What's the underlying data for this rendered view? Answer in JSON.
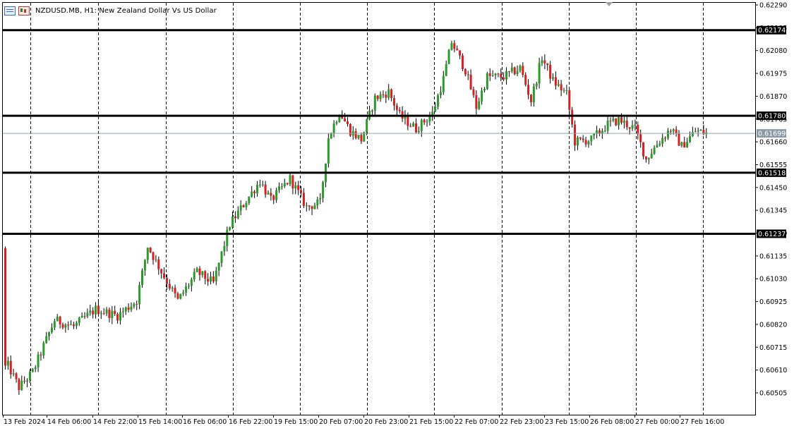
{
  "header": {
    "symbol": "NZDUSD.MB",
    "timeframe": "H1",
    "description": "New Zealand Dollar Vs US Dollar",
    "title": "NZDUSD.MB, H1:  New Zealand Dollar Vs US Dollar"
  },
  "icons": {
    "menu_icon": "list-icon",
    "chart_icon": "candlestick-chart-icon",
    "dropdown": "triangle-down-icon"
  },
  "colors": {
    "bull": "#2b9a2b",
    "bear": "#d42020",
    "wick": "#000000",
    "grid": "#000000",
    "hline": "#000000",
    "bid_line": "#8fa3b0",
    "bid_label_bg": "#8c9aa5",
    "label_bg": "#000000",
    "label_text": "#ffffff"
  },
  "chart_data": {
    "type": "candlestick",
    "title": "NZDUSD.MB, H1:  New Zealand Dollar Vs US Dollar",
    "ylim": [
      0.6045,
      0.6229
    ],
    "y_ticks": [
      "0.62290",
      "0.62185",
      "0.62080",
      "0.61975",
      "0.61870",
      "0.61765",
      "0.61660",
      "0.61555",
      "0.61450",
      "0.61345",
      "0.61240",
      "0.61135",
      "0.61030",
      "0.60925",
      "0.60820",
      "0.60715",
      "0.60610",
      "0.60505"
    ],
    "x_ticks": [
      "13 Feb 2024",
      "14 Feb 06:00",
      "14 Feb 22:00",
      "15 Feb 14:00",
      "16 Feb 06:00",
      "16 Feb 22:00",
      "19 Feb 15:00",
      "20 Feb 07:00",
      "20 Feb 23:00",
      "21 Feb 15:00",
      "22 Feb 07:00",
      "22 Feb 23:00",
      "23 Feb 15:00",
      "26 Feb 08:00",
      "27 Feb 00:00",
      "27 Feb 16:00"
    ],
    "vertical_grid": "dashed, at every x tick",
    "horizontal_lines": [
      "0.62174",
      "0.61780",
      "0.61518",
      "0.61237"
    ],
    "bid_price": "0.61699",
    "anchors": [
      {
        "bar": 0,
        "price": 0.6115
      },
      {
        "bar": 1,
        "price": 0.6063
      },
      {
        "bar": 5,
        "price": 0.6053
      },
      {
        "bar": 10,
        "price": 0.606
      },
      {
        "bar": 18,
        "price": 0.6084
      },
      {
        "bar": 25,
        "price": 0.6081
      },
      {
        "bar": 33,
        "price": 0.6089
      },
      {
        "bar": 41,
        "price": 0.6086
      },
      {
        "bar": 48,
        "price": 0.6093
      },
      {
        "bar": 52,
        "price": 0.6118
      },
      {
        "bar": 58,
        "price": 0.6104
      },
      {
        "bar": 63,
        "price": 0.6093
      },
      {
        "bar": 70,
        "price": 0.6106
      },
      {
        "bar": 76,
        "price": 0.6101
      },
      {
        "bar": 82,
        "price": 0.6128
      },
      {
        "bar": 88,
        "price": 0.6139
      },
      {
        "bar": 93,
        "price": 0.6148
      },
      {
        "bar": 97,
        "price": 0.6139
      },
      {
        "bar": 104,
        "price": 0.6149
      },
      {
        "bar": 110,
        "price": 0.6136
      },
      {
        "bar": 115,
        "price": 0.6138
      },
      {
        "bar": 118,
        "price": 0.6168
      },
      {
        "bar": 122,
        "price": 0.618
      },
      {
        "bar": 126,
        "price": 0.6171
      },
      {
        "bar": 130,
        "price": 0.6167
      },
      {
        "bar": 135,
        "price": 0.6186
      },
      {
        "bar": 140,
        "price": 0.6189
      },
      {
        "bar": 144,
        "price": 0.6178
      },
      {
        "bar": 150,
        "price": 0.6172
      },
      {
        "bar": 156,
        "price": 0.6179
      },
      {
        "bar": 160,
        "price": 0.6195
      },
      {
        "bar": 163,
        "price": 0.6212
      },
      {
        "bar": 168,
        "price": 0.6199
      },
      {
        "bar": 172,
        "price": 0.6182
      },
      {
        "bar": 176,
        "price": 0.6196
      },
      {
        "bar": 182,
        "price": 0.6196
      },
      {
        "bar": 188,
        "price": 0.62
      },
      {
        "bar": 192,
        "price": 0.6185
      },
      {
        "bar": 196,
        "price": 0.6205
      },
      {
        "bar": 200,
        "price": 0.6194
      },
      {
        "bar": 205,
        "price": 0.6188
      },
      {
        "bar": 208,
        "price": 0.6166
      },
      {
        "bar": 214,
        "price": 0.6167
      },
      {
        "bar": 220,
        "price": 0.6174
      },
      {
        "bar": 224,
        "price": 0.6176
      },
      {
        "bar": 230,
        "price": 0.6172
      },
      {
        "bar": 234,
        "price": 0.6158
      },
      {
        "bar": 238,
        "price": 0.6165
      },
      {
        "bar": 243,
        "price": 0.6172
      },
      {
        "bar": 247,
        "price": 0.6164
      },
      {
        "bar": 252,
        "price": 0.6171
      },
      {
        "bar": 256,
        "price": 0.617
      }
    ]
  }
}
